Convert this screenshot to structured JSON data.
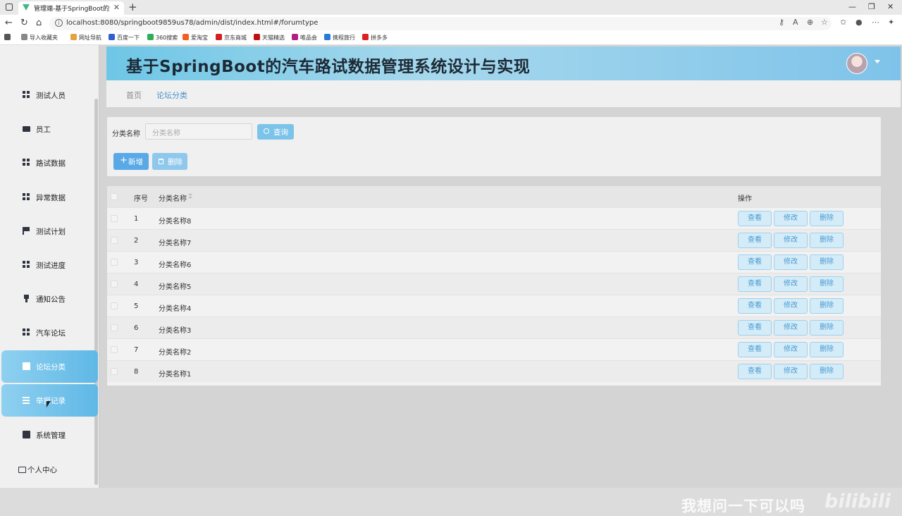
{
  "browser": {
    "tab_title": "管理端-基于SpringBoot的汽车路",
    "url": "localhost:8080/springboot9859us78/admin/dist/index.html#/forumtype",
    "bookmarks": [
      "导入收藏夹",
      "网址导航",
      "百度一下",
      "360搜索",
      "爱淘宝",
      "京东商城",
      "天猫精选",
      "唯品会",
      "携程旅行",
      "拼多多"
    ]
  },
  "header": {
    "title": "基于SpringBoot的汽车路试数据管理系统设计与实现"
  },
  "sidebar": {
    "items": [
      {
        "label": "测试人员",
        "icon": "grid-icon"
      },
      {
        "label": "员工",
        "icon": "briefcase-icon"
      },
      {
        "label": "路试数据",
        "icon": "grid-icon"
      },
      {
        "label": "异常数据",
        "icon": "grid-icon"
      },
      {
        "label": "测试计划",
        "icon": "flag-icon"
      },
      {
        "label": "测试进度",
        "icon": "grid-icon"
      },
      {
        "label": "通知公告",
        "icon": "pin-icon"
      },
      {
        "label": "汽车论坛",
        "icon": "grid-icon"
      },
      {
        "label": "论坛分类",
        "icon": "clipboard-icon",
        "active": true
      },
      {
        "label": "举报记录",
        "icon": "list-icon",
        "active": true
      },
      {
        "label": "系统管理",
        "icon": "clipboard-icon"
      }
    ],
    "user_center": "个人中心"
  },
  "breadcrumb": {
    "home": "首页",
    "current": "论坛分类"
  },
  "search": {
    "label": "分类名称",
    "placeholder": "分类名称",
    "query_button": "查询",
    "add_button": "新增",
    "delete_button": "删除"
  },
  "table": {
    "headers": {
      "index": "序号",
      "name": "分类名称",
      "actions": "操作"
    },
    "rows": [
      {
        "index": "1",
        "name": "分类名称8"
      },
      {
        "index": "2",
        "name": "分类名称7"
      },
      {
        "index": "3",
        "name": "分类名称6"
      },
      {
        "index": "4",
        "name": "分类名称5"
      },
      {
        "index": "5",
        "name": "分类名称4"
      },
      {
        "index": "6",
        "name": "分类名称3"
      },
      {
        "index": "7",
        "name": "分类名称2"
      },
      {
        "index": "8",
        "name": "分类名称1"
      }
    ],
    "row_actions": {
      "view": "查看",
      "edit": "修改",
      "delete": "删除"
    }
  },
  "overlay": {
    "subtitle": "我想问一下可以吗",
    "logo": "bilibili"
  },
  "colors": {
    "accent": "#58a9e6",
    "header_gradient_start": "#6ec6e6",
    "active_menu": "#5fb8e6"
  }
}
